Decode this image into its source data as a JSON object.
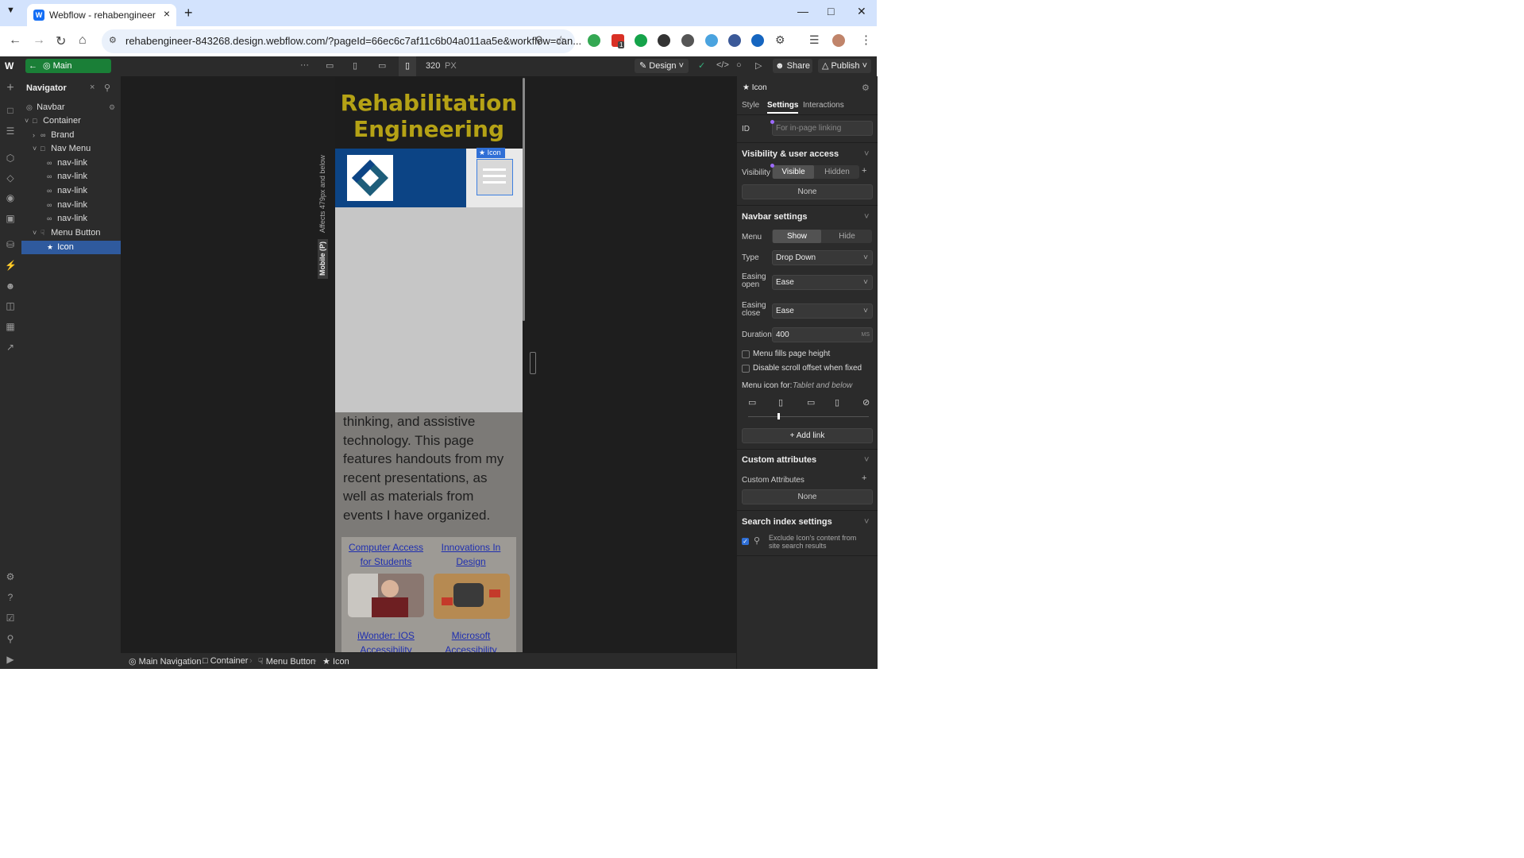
{
  "browser": {
    "tab_title": "Webflow - rehabengineer",
    "url": "rehabengineer-843268.design.webflow.com/?pageId=66ec6c7af11c6b04a011aa5e&workflow=can...",
    "ext_badge": "1"
  },
  "webflow_top": {
    "symbol_label": "Main Navigation",
    "width_value": "320",
    "width_unit": "PX",
    "mode_label": "Design",
    "share_label": "Share",
    "publish_label": "Publish",
    "more_label": "···"
  },
  "navigator": {
    "title": "Navigator",
    "items": [
      {
        "label": "Navbar"
      },
      {
        "label": "Container"
      },
      {
        "label": "Brand"
      },
      {
        "label": "Nav Menu"
      },
      {
        "label": "nav-link"
      },
      {
        "label": "nav-link"
      },
      {
        "label": "nav-link"
      },
      {
        "label": "nav-link"
      },
      {
        "label": "nav-link"
      },
      {
        "label": "Menu Button"
      },
      {
        "label": "Icon"
      }
    ]
  },
  "canvas": {
    "hero_title": "Rehabilitation Engineering",
    "selected_tag": "Icon",
    "breakpoint_note": "Affects 479px and below",
    "breakpoint_name": "Mobile (P)",
    "body_lines": [
      "thinking, and assistive",
      "technology. This page",
      "features handouts from my",
      "recent presentations, as",
      "well as materials from",
      "events I have organized."
    ],
    "cards": [
      {
        "line1": "Computer Access",
        "line2": "for Students"
      },
      {
        "line1": "Innovations In",
        "line2": "Design"
      },
      {
        "line1": "iWonder: IOS",
        "line2": "Accessibility"
      },
      {
        "line1": "Microsoft",
        "line2": "Accessibility"
      }
    ]
  },
  "breadcrumbs": [
    "Main Navigation",
    "Container",
    "Menu Button",
    "Icon"
  ],
  "right_panel": {
    "element_name": "Icon",
    "tabs": [
      "Style",
      "Settings",
      "Interactions"
    ],
    "active_tab": "Settings",
    "id_label": "ID",
    "id_placeholder": "For in-page linking",
    "visibility_header": "Visibility & user access",
    "visibility_label": "Visibility",
    "visible_label": "Visible",
    "hidden_label": "Hidden",
    "visibility_none": "None",
    "navbar_header": "Navbar settings",
    "menu_label": "Menu",
    "show_label": "Show",
    "hide_label": "Hide",
    "type_label": "Type",
    "type_value": "Drop Down",
    "easing_open_label_1": "Easing",
    "easing_open_label_2": "open",
    "easing_open_value": "Ease",
    "easing_close_label_1": "Easing",
    "easing_close_label_2": "close",
    "easing_close_value": "Ease",
    "duration_label": "Duration",
    "duration_value": "400",
    "duration_unit": "MS",
    "fills_label": "Menu fills page height",
    "scroll_label": "Disable scroll offset when fixed",
    "menu_icon_label": "Menu icon for:",
    "menu_icon_value": "Tablet and below",
    "add_link_label": "Add link",
    "custom_attr_header": "Custom attributes",
    "custom_attr_label": "Custom Attributes",
    "custom_attr_none": "None",
    "search_header": "Search index settings",
    "search_exclude_1": "Exclude Icon's content from",
    "search_exclude_2": "site search results"
  },
  "colors": {
    "accent_blue": "#2f5a9e",
    "symbol_green": "#1a7f37",
    "hero_gold": "#b5a215",
    "navbar_blue": "#0c4485"
  }
}
